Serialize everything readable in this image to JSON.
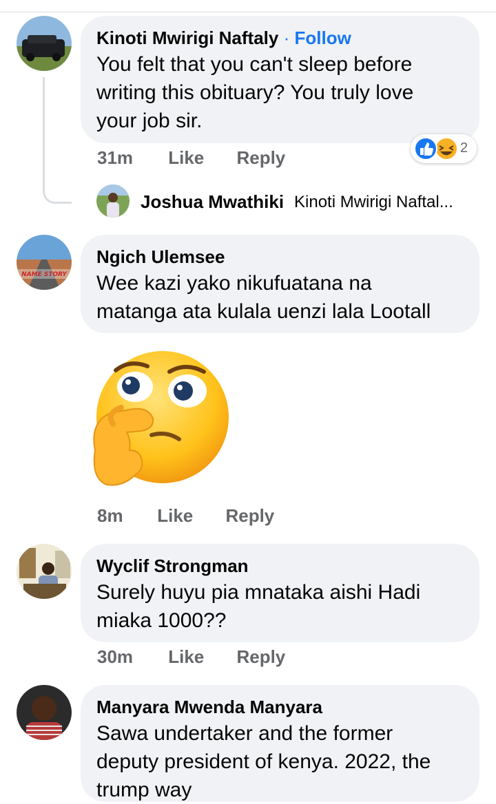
{
  "comments": [
    {
      "name": "Kinoti Mwirigi Naftaly",
      "follow": "Follow",
      "separator": "·",
      "lines": [
        "You felt that you can't sleep before",
        "writing this obituary? You truly love",
        "your job sir."
      ],
      "time": "31m",
      "like": "Like",
      "reply": "Reply",
      "reaction_count": "2",
      "reaction_icons": [
        "like-icon",
        "haha-icon"
      ],
      "replies": [
        {
          "name": "Joshua Mwathiki",
          "snippet": "Kinoti Mwirigi Naftal..."
        }
      ]
    },
    {
      "name": "Ngich Ulemsee",
      "lines": [
        "Wee kazi yako nikufuatana na",
        "matanga ata kulala uenzi lala Lootall"
      ],
      "sticker": "thinking-face-emoji",
      "time": "8m",
      "like": "Like",
      "reply": "Reply",
      "avatar_text": "NAME STORY"
    },
    {
      "name": "Wyclif Strongman",
      "lines": [
        "Surely huyu pia mnataka aishi Hadi",
        "miaka 1000??"
      ],
      "time": "30m",
      "like": "Like",
      "reply": "Reply"
    },
    {
      "name": "Manyara Mwenda Manyara",
      "lines": [
        "Sawa undertaker and the former",
        "deputy president of kenya. 2022, the",
        "trump way"
      ]
    }
  ],
  "colors": {
    "bubble": "#f0f2f5",
    "link": "#1877f2",
    "meta": "#65676b",
    "text": "#050505"
  }
}
